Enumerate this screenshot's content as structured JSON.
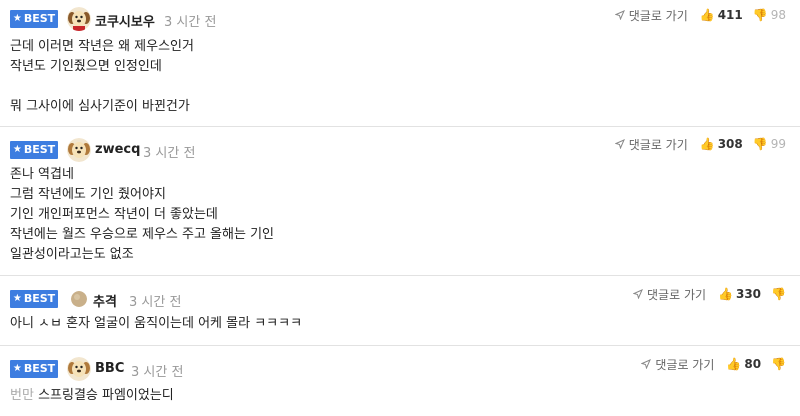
{
  "badge_label": "BEST",
  "reply_label": "댓글로 가기",
  "comments": [
    {
      "nickname": "코쿠시보우",
      "time": "3 시간 전",
      "likes": "411",
      "dislikes": "98",
      "lines": [
        "근데 이러면 작년은 왜 제우스인거",
        "작년도 기인줬으면 인정인데",
        "",
        "뭐 그사이에 심사기준이 바뀐건가"
      ]
    },
    {
      "nickname": "zwecq",
      "time": "3 시간 전",
      "likes": "308",
      "dislikes": "99",
      "lines": [
        "존나 역겹네",
        "그럼 작년에도 기인 줬어야지",
        "기인 개인퍼포먼스 작년이 더 좋았는데",
        "작년에는 월즈 우승으로 제우스 주고 올해는 기인",
        "일관성이라고는도 없조"
      ]
    },
    {
      "nickname": "추격",
      "time": "3 시간 전",
      "likes": "330",
      "dislikes": "",
      "lines": [
        "아니 ㅅㅂ 혼자 얼굴이 움직이는데 어케 몰라 ㅋㅋㅋㅋ"
      ]
    },
    {
      "nickname": "BBC",
      "time": "3 시간 전",
      "likes": "80",
      "dislikes": "",
      "body_prefix": "번만",
      "lines": [
        "스프링결승 파엠이었는디"
      ]
    }
  ],
  "colors": {
    "badge": "#3d7de0",
    "divider": "#e2e2e2",
    "meta": "#999999"
  },
  "icons": [
    "star-icon",
    "send-icon",
    "thumbs-up-icon",
    "thumbs-down-icon",
    "dog-avatar",
    "ball-avatar"
  ]
}
